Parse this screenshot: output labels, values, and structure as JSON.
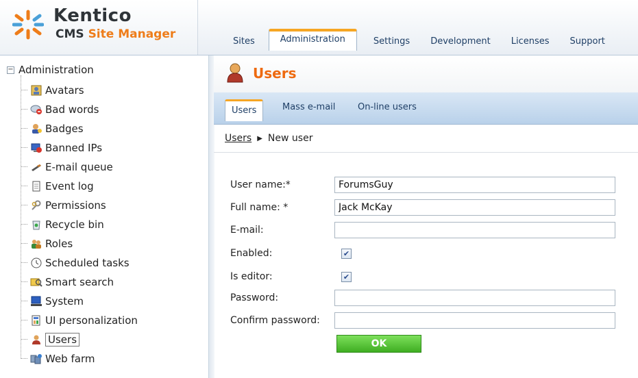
{
  "header": {
    "logo_line1": "Kentico",
    "logo_line2_a": "CMS ",
    "logo_line2_b": "Site Manager",
    "tabs": [
      {
        "label": "Sites"
      },
      {
        "label": "Administration",
        "active": true
      },
      {
        "label": "Settings"
      },
      {
        "label": "Development"
      },
      {
        "label": "Licenses"
      },
      {
        "label": "Support"
      }
    ]
  },
  "tree": {
    "root_label": "Administration",
    "expander": "−",
    "items": [
      {
        "label": "Avatars",
        "icon": "avatar-icon"
      },
      {
        "label": "Bad words",
        "icon": "bad-words-icon"
      },
      {
        "label": "Badges",
        "icon": "badge-icon"
      },
      {
        "label": "Banned IPs",
        "icon": "banned-ip-icon"
      },
      {
        "label": "E-mail queue",
        "icon": "email-queue-icon"
      },
      {
        "label": "Event log",
        "icon": "event-log-icon"
      },
      {
        "label": "Permissions",
        "icon": "permissions-icon"
      },
      {
        "label": "Recycle bin",
        "icon": "recycle-bin-icon"
      },
      {
        "label": "Roles",
        "icon": "roles-icon"
      },
      {
        "label": "Scheduled tasks",
        "icon": "clock-icon"
      },
      {
        "label": "Smart search",
        "icon": "smart-search-icon"
      },
      {
        "label": "System",
        "icon": "computer-icon"
      },
      {
        "label": "UI personalization",
        "icon": "ui-personalization-icon"
      },
      {
        "label": "Users",
        "icon": "user-icon",
        "selected": true
      },
      {
        "label": "Web farm",
        "icon": "web-farm-icon"
      }
    ]
  },
  "page": {
    "title": "Users",
    "sub_tabs": [
      {
        "label": "Users",
        "active": true
      },
      {
        "label": "Mass e-mail"
      },
      {
        "label": "On-line users"
      }
    ],
    "breadcrumb": {
      "link": "Users",
      "current": "New user"
    }
  },
  "form": {
    "username_label": "User name:*",
    "username_value": "ForumsGuy",
    "fullname_label": "Full name: *",
    "fullname_value": "Jack McKay",
    "email_label": "E-mail:",
    "email_value": "",
    "enabled_label": "Enabled:",
    "enabled_checked": true,
    "is_editor_label": "Is editor:",
    "is_editor_checked": true,
    "password_label": "Password:",
    "password_value": "",
    "confirm_password_label": "Confirm password:",
    "confirm_password_value": "",
    "ok_label": "OK"
  },
  "colors": {
    "accent_orange": "#ee6a10",
    "tab_highlight": "#f6a623",
    "ok_green": "#3fae22"
  }
}
